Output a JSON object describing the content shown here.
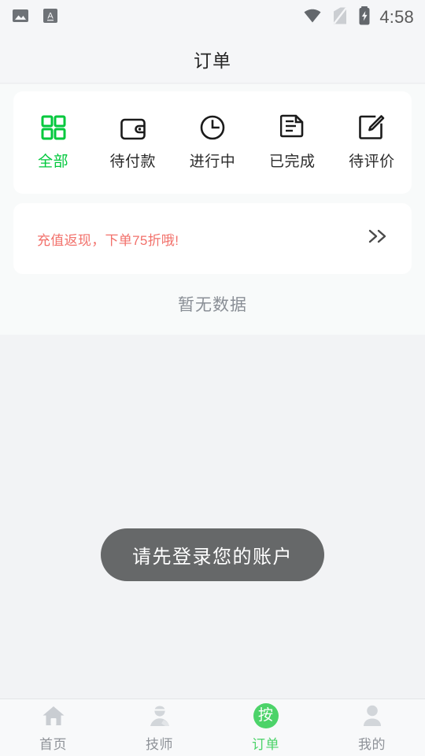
{
  "statusbar": {
    "time": "4:58",
    "left_icons": [
      "image-notification-icon",
      "input-method-a-icon"
    ],
    "right_icons": [
      "wifi-icon",
      "no-sim-icon",
      "battery-charging-icon"
    ]
  },
  "header": {
    "title": "订单"
  },
  "order_tabs": {
    "active_index": 0,
    "items": [
      {
        "label": "全部",
        "icon": "grid-icon"
      },
      {
        "label": "待付款",
        "icon": "wallet-icon"
      },
      {
        "label": "进行中",
        "icon": "clock-icon"
      },
      {
        "label": "已完成",
        "icon": "document-icon"
      },
      {
        "label": "待评价",
        "icon": "edit-icon"
      }
    ]
  },
  "promo": {
    "text": "充值返现，下单75折哦!",
    "arrow": "〉〉",
    "arrow_icon": "double-chevron-right-icon"
  },
  "empty_state": {
    "text": "暂无数据"
  },
  "toast": {
    "message": "请先登录您的账户"
  },
  "bottom_nav": {
    "active_index": 2,
    "items": [
      {
        "label": "首页",
        "icon": "home-icon",
        "badge": ""
      },
      {
        "label": "技师",
        "icon": "technician-icon",
        "badge": ""
      },
      {
        "label": "订单",
        "icon": "order-badge-icon",
        "badge": "按"
      },
      {
        "label": "我的",
        "icon": "profile-icon",
        "badge": ""
      }
    ]
  },
  "colors": {
    "accent_green": "#00C83C",
    "nav_green": "#4CD369",
    "promo_red": "#F2716B",
    "page_bg": "#F2F3F5",
    "card_bg": "#FFFFFF",
    "toast_bg": "#666869"
  }
}
